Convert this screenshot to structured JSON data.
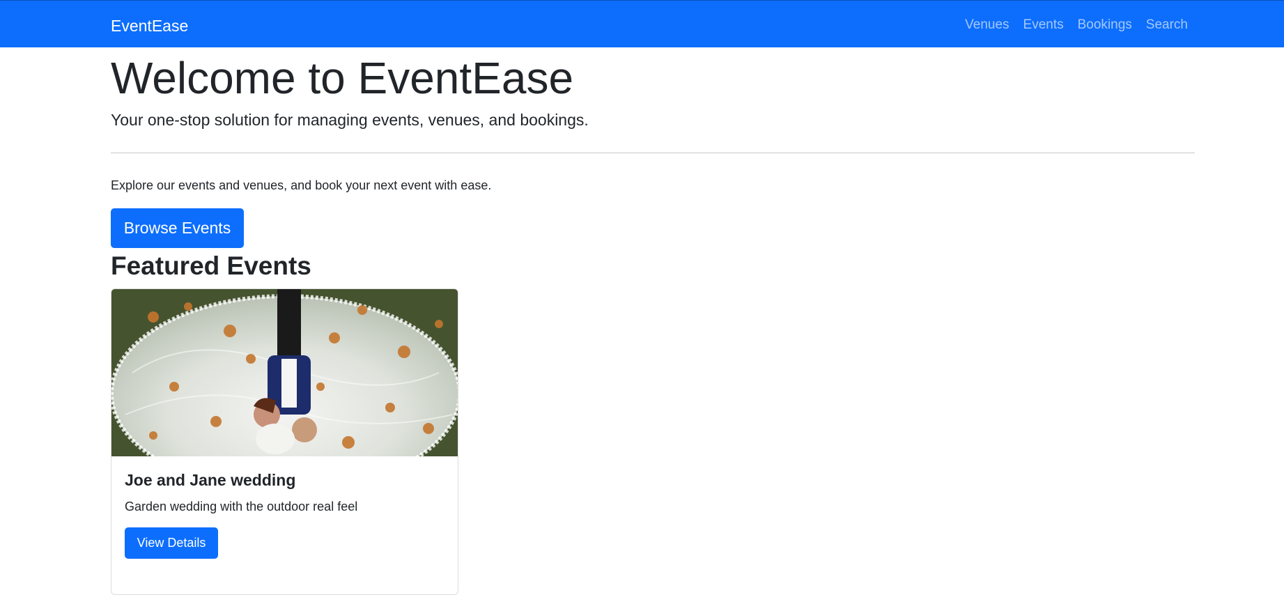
{
  "navbar": {
    "brand": "EventEase",
    "links": [
      "Venues",
      "Events",
      "Bookings",
      "Search"
    ],
    "color": "#0d6efd"
  },
  "hero": {
    "title": "Welcome to EventEase",
    "lead": "Your one-stop solution for managing events, venues, and bookings.",
    "explore_text": "Explore our events and venues, and book your next event with ease.",
    "browse_button": "Browse Events"
  },
  "featured": {
    "heading": "Featured Events",
    "events": [
      {
        "title": "Joe and Jane wedding",
        "description": "Garden wedding with the outdoor real feel",
        "button": "View Details",
        "image_icon": "wedding-photo"
      }
    ]
  }
}
